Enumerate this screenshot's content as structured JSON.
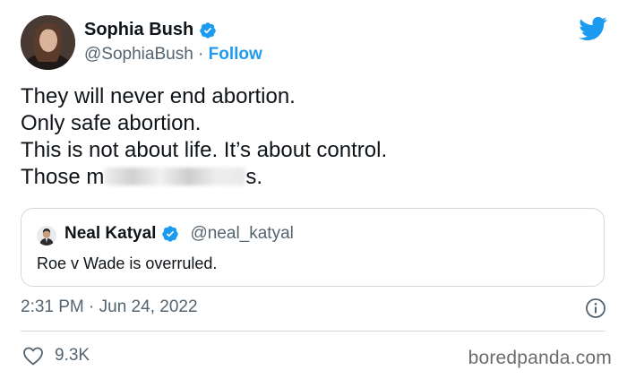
{
  "author": {
    "name": "Sophia Bush",
    "handle": "@SophiaBush",
    "separator": "·",
    "follow_label": "Follow"
  },
  "tweet": {
    "lines": [
      "They will never end abortion.",
      "Only safe abortion.",
      "This is not about life. It’s about control."
    ],
    "last_line_start": "Those m",
    "last_line_end": "s."
  },
  "quoted_tweet": {
    "name": "Neal Katyal",
    "handle": "@neal_katyal",
    "text": "Roe v Wade is overruled."
  },
  "timestamp": "2:31 PM · Jun 24, 2022",
  "likes": "9.3K",
  "watermark": "boredpanda.com",
  "colors": {
    "accent": "#1d9bf0",
    "text": "#0f1419",
    "secondary": "#536471",
    "border": "#cfd9de"
  },
  "icons": [
    "verified-badge-icon",
    "twitter-bird-icon",
    "info-icon",
    "heart-icon"
  ]
}
